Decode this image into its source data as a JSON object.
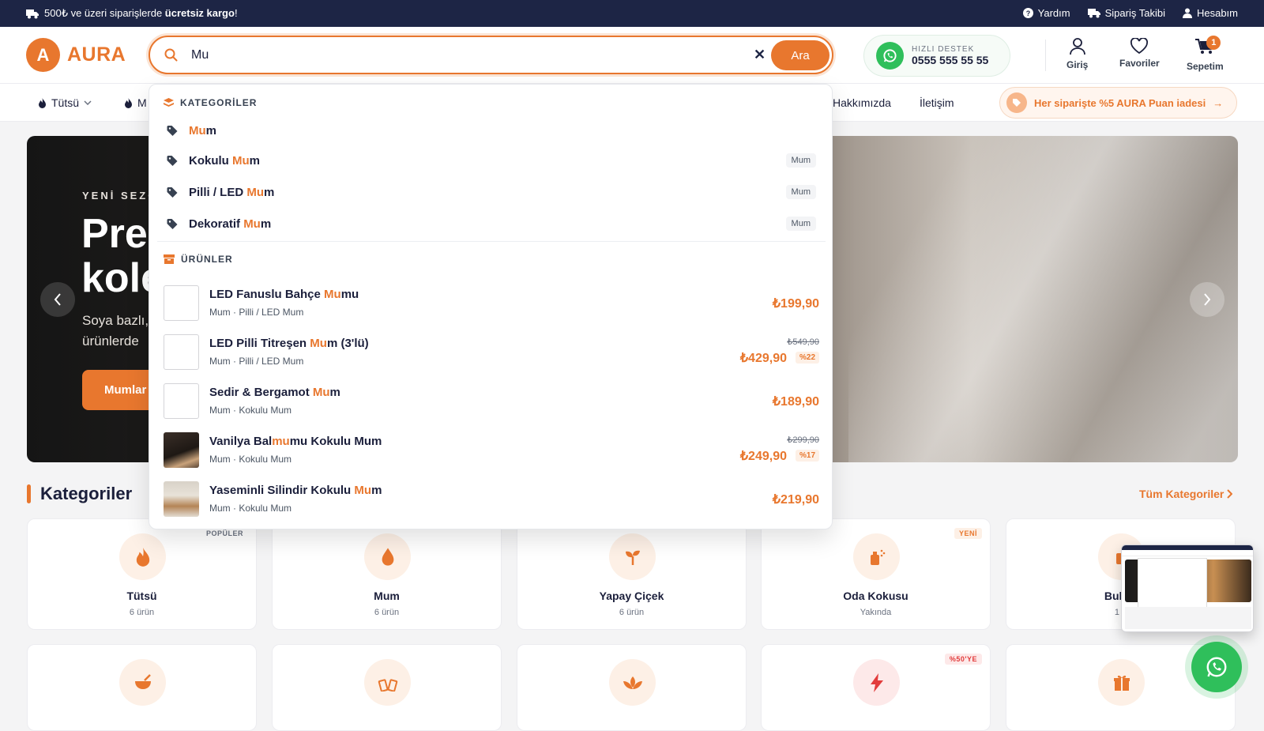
{
  "topbar": {
    "promo_prefix": "500₺ ve üzeri siparişlerde ",
    "promo_bold": "ücretsiz kargo",
    "promo_suffix": "!",
    "help": "Yardım",
    "order_tracking": "Sipariş Takibi",
    "account": "Hesabım"
  },
  "header": {
    "logo_letter": "A",
    "logo_text": "AURA",
    "search_value": "Mu",
    "search_button": "Ara",
    "support_label": "HIZLI DESTEK",
    "support_phone": "0555 555 55 55",
    "login": "Giriş",
    "favorites": "Favoriler",
    "cart": "Sepetim",
    "cart_count": "1"
  },
  "nav": {
    "items": [
      "Tütsü",
      "M",
      "Hakkımızda",
      "İletişim"
    ],
    "promo": "Her siparişte %5 AURA Puan iadesi"
  },
  "hero": {
    "eyebrow": "YENİ SEZO",
    "title_line1": "Pre",
    "title_line2": "kole",
    "desc_line1": "Soya bazlı,",
    "desc_line2": "ürünlerde",
    "cta": "Mumlar"
  },
  "search_dropdown": {
    "categories_title": "KATEGORİLER",
    "categories": [
      {
        "pre": "",
        "hl": "Mu",
        "post": "m",
        "parent": ""
      },
      {
        "pre": "Kokulu ",
        "hl": "Mu",
        "post": "m",
        "parent": "Mum"
      },
      {
        "pre": "Pilli / LED ",
        "hl": "Mu",
        "post": "m",
        "parent": "Mum"
      },
      {
        "pre": "Dekoratif ",
        "hl": "Mu",
        "post": "m",
        "parent": "Mum"
      }
    ],
    "products_title": "ÜRÜNLER",
    "products": [
      {
        "pre": "LED Fanuslu Bahçe ",
        "hl": "Mu",
        "post": "mu",
        "meta": "Mum · Pilli / LED Mum",
        "price": "₺199,90",
        "old_price": "",
        "discount": ""
      },
      {
        "pre": "LED Pilli Titreşen ",
        "hl": "Mu",
        "post": "m (3'lü)",
        "meta": "Mum · Pilli / LED Mum",
        "price": "₺429,90",
        "old_price": "₺549,90",
        "discount": "%22"
      },
      {
        "pre": "Sedir & Bergamot ",
        "hl": "Mu",
        "post": "m",
        "meta": "Mum · Kokulu Mum",
        "price": "₺189,90",
        "old_price": "",
        "discount": ""
      },
      {
        "pre": "Vanilya Bal",
        "hl": "mu",
        "post": "mu Kokulu Mum",
        "meta": "Mum · Kokulu Mum",
        "price": "₺249,90",
        "old_price": "₺299,90",
        "discount": "%17"
      },
      {
        "pre": "Yaseminli Silindir Kokulu ",
        "hl": "Mu",
        "post": "m",
        "meta": "Mum · Kokulu Mum",
        "price": "₺219,90",
        "old_price": "",
        "discount": ""
      }
    ]
  },
  "categories_section": {
    "title": "Kategoriler",
    "all_link": "Tüm Kategoriler",
    "cards": [
      {
        "name": "Tütsü",
        "count": "6 ürün",
        "tag": "POPÜLER"
      },
      {
        "name": "Mum",
        "count": "6 ürün",
        "tag": ""
      },
      {
        "name": "Yapay Çiçek",
        "count": "6 ürün",
        "tag": ""
      },
      {
        "name": "Oda Kokusu",
        "count": "Yakında",
        "tag": "YENİ"
      },
      {
        "name": "Buhur",
        "count": "1 ü",
        "tag": ""
      },
      {
        "name": "",
        "count": "",
        "tag": ""
      },
      {
        "name": "",
        "count": "",
        "tag": ""
      },
      {
        "name": "",
        "count": "",
        "tag": ""
      },
      {
        "name": "",
        "count": "",
        "tag": "%50'YE"
      },
      {
        "name": "",
        "count": "",
        "tag": ""
      }
    ]
  },
  "colors": {
    "accent": "#e8772e",
    "navy": "#1d2545",
    "whatsapp": "#2fbf5b"
  }
}
